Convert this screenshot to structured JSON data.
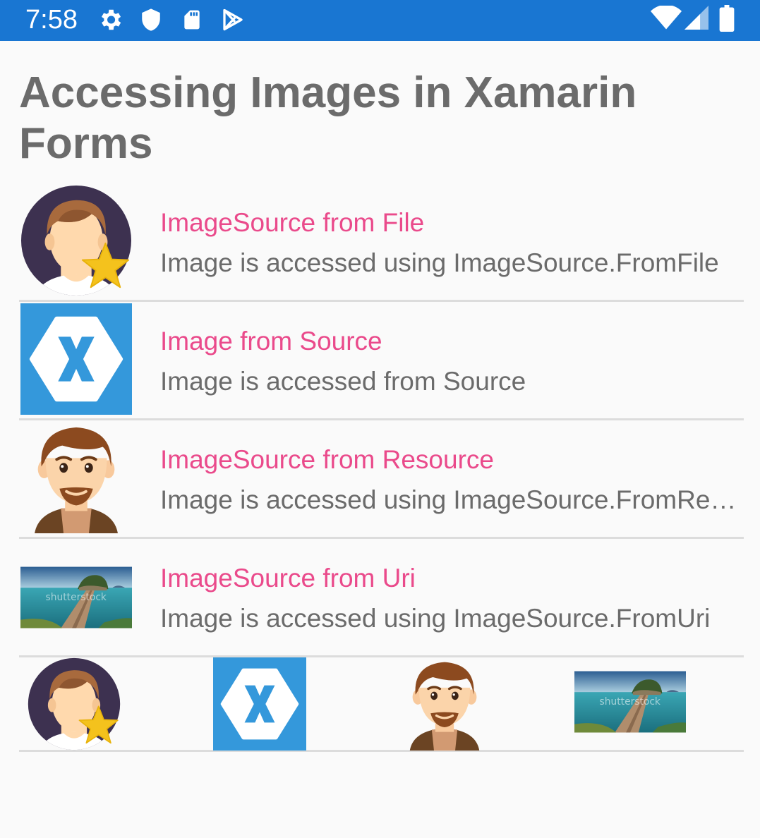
{
  "status_bar": {
    "time": "7:58",
    "left_icons": [
      "gear-icon",
      "shield-icon",
      "sd-card-icon",
      "play-store-icon"
    ],
    "right_icons": [
      "wifi-icon",
      "cell-signal-icon",
      "battery-icon"
    ],
    "color": "#1976d2"
  },
  "page": {
    "title": "Accessing Images in Xamarin Forms"
  },
  "list": {
    "items": [
      {
        "title": "ImageSource from File",
        "subtitle": "Image is accessed using ImageSource.FromFile",
        "image": "avatar-star"
      },
      {
        "title": "Image from Source",
        "subtitle": "Image is accessed from Source",
        "image": "xamarin-logo"
      },
      {
        "title": "ImageSource from Resource",
        "subtitle": "Image is accessed using ImageSource.FromResource",
        "image": "cartoon-man"
      },
      {
        "title": "ImageSource from Uri",
        "subtitle": "Image is accessed using ImageSource.FromUri",
        "image": "landscape-photo"
      }
    ]
  },
  "gallery": {
    "images": [
      "avatar-star",
      "xamarin-logo",
      "cartoon-man",
      "landscape-photo"
    ]
  },
  "colors": {
    "title_text": "#6b6b6b",
    "item_title": "#ea4a8b",
    "item_subtitle": "#6b6b6b",
    "xamarin_blue": "#3498db",
    "divider": "#dcdcdc"
  }
}
